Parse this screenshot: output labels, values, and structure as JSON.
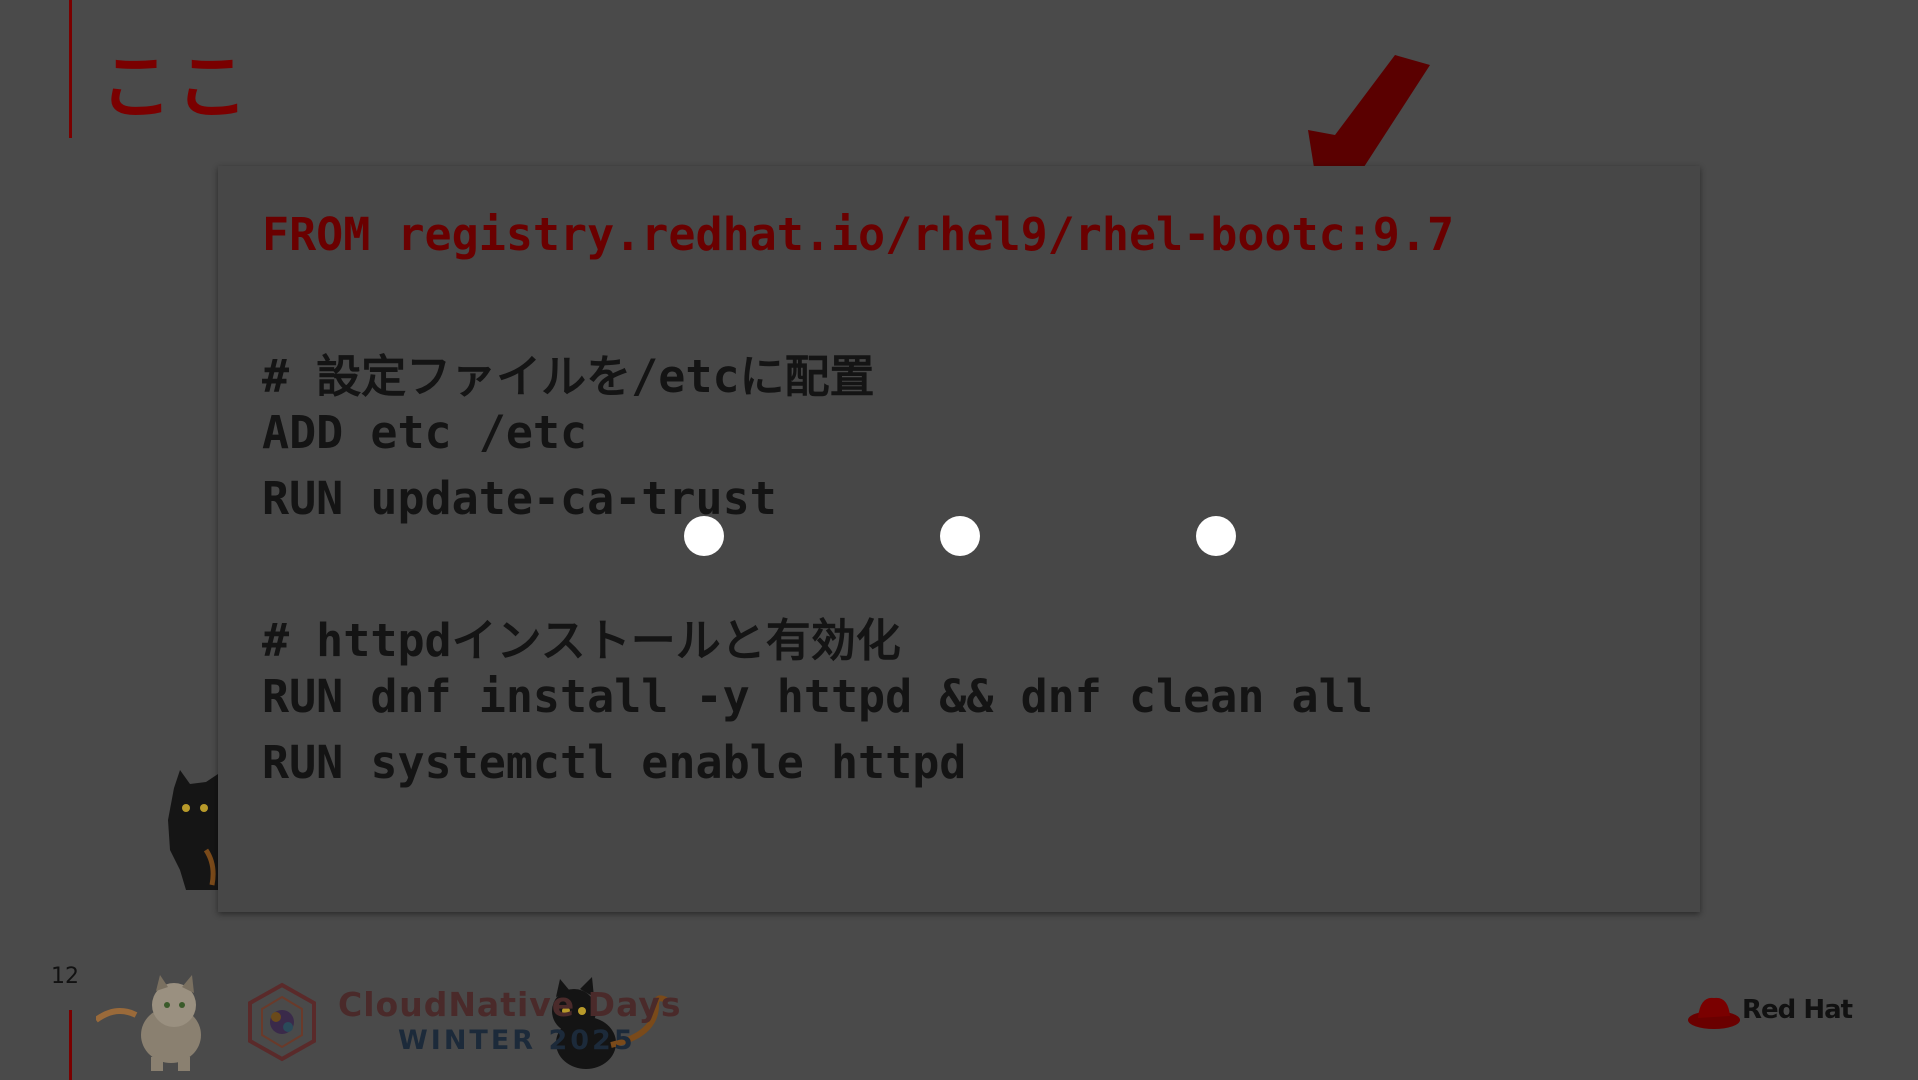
{
  "slide": {
    "title": "ここ",
    "page_number": "12"
  },
  "code": {
    "lines": [
      "FROM registry.redhat.io/rhel9/rhel-bootc:9.7",
      "# 設定ファイルを/etcに配置",
      "ADD etc /etc",
      "RUN update-ca-trust",
      "# httpdインストールと有効化",
      "RUN dnf install -y httpd && dnf clean all",
      "RUN systemctl enable httpd"
    ]
  },
  "footer": {
    "event_title": "CloudNative Days",
    "event_subtitle": "WINTER 2025",
    "brand": "Red Hat"
  },
  "colors": {
    "accent_red": "#7a0000",
    "background": "#4a4a4a",
    "loading_dots": "#ffffff"
  },
  "icons": [
    "arrow-down-left-icon",
    "cat-mascot-icon",
    "cncf-logo-icon",
    "redhat-logo-icon"
  ]
}
